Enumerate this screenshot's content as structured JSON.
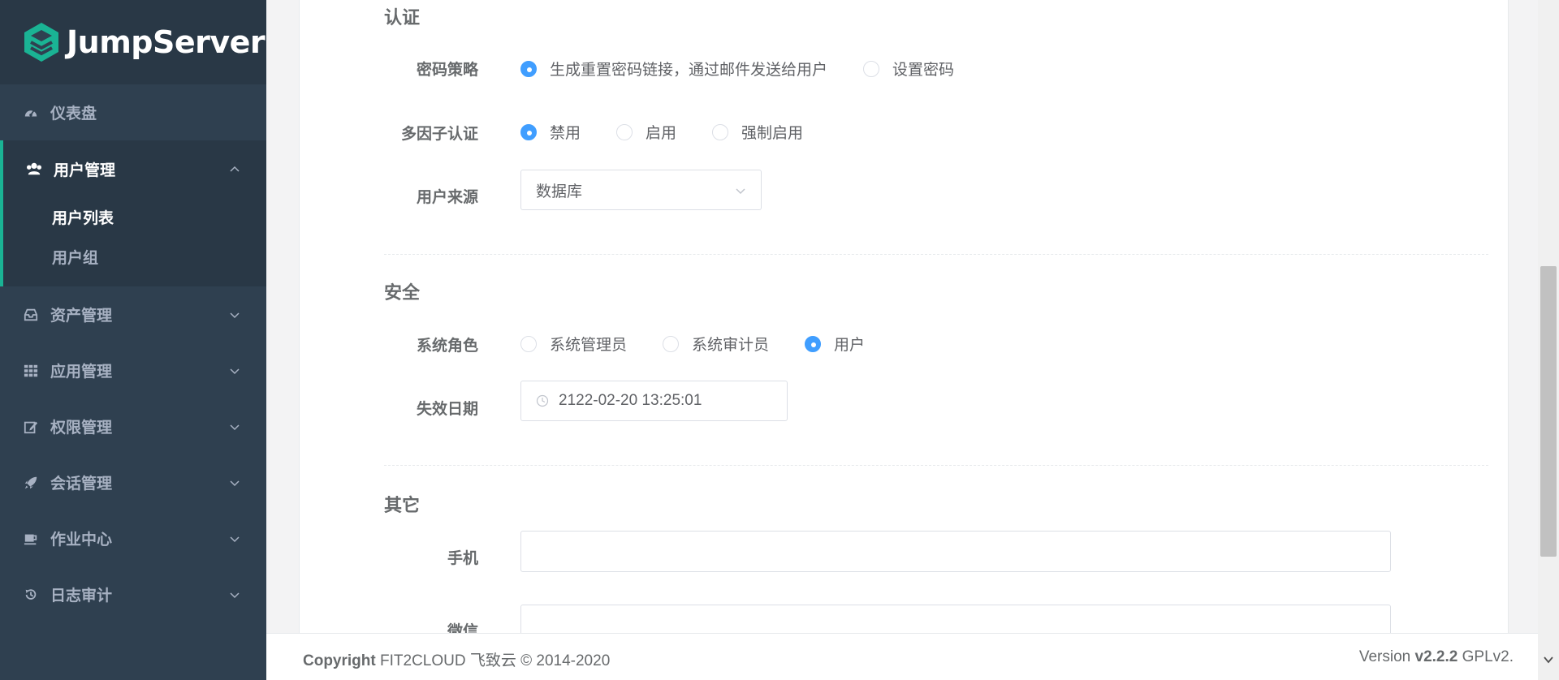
{
  "sidebar": {
    "logo_text": "JumpServer",
    "items": [
      {
        "label": "仪表盘",
        "icon": "dashboard-icon"
      },
      {
        "label": "用户管理",
        "icon": "users-icon"
      },
      {
        "label": "资产管理",
        "icon": "inbox-icon"
      },
      {
        "label": "应用管理",
        "icon": "grid-icon"
      },
      {
        "label": "权限管理",
        "icon": "edit-icon"
      },
      {
        "label": "会话管理",
        "icon": "rocket-icon"
      },
      {
        "label": "作业中心",
        "icon": "coffee-icon"
      },
      {
        "label": "日志审计",
        "icon": "history-icon"
      }
    ],
    "sub_items": [
      "用户列表",
      "用户组"
    ]
  },
  "form": {
    "auth": {
      "title": "认证",
      "password_strategy": {
        "label": "密码策略",
        "options": [
          "生成重置密码链接，通过邮件发送给用户",
          "设置密码"
        ],
        "selected": "生成重置密码链接，通过邮件发送给用户"
      },
      "mfa": {
        "label": "多因子认证",
        "options": [
          "禁用",
          "启用",
          "强制启用"
        ],
        "selected": "禁用"
      },
      "source": {
        "label": "用户来源",
        "value": "数据库"
      }
    },
    "security": {
      "title": "安全",
      "role": {
        "label": "系统角色",
        "options": [
          "系统管理员",
          "系统审计员",
          "用户"
        ],
        "selected": "用户"
      },
      "expire": {
        "label": "失效日期",
        "value": "2122-02-20 13:25:01"
      }
    },
    "other": {
      "title": "其它",
      "phone_label": "手机",
      "wechat_label": "微信"
    }
  },
  "footer": {
    "copyright_bold": "Copyright",
    "copyright_rest": " FIT2CLOUD 飞致云 © 2014-2020",
    "version_prefix": "Version ",
    "version_bold": "v2.2.2",
    "version_suffix": " GPLv2."
  }
}
